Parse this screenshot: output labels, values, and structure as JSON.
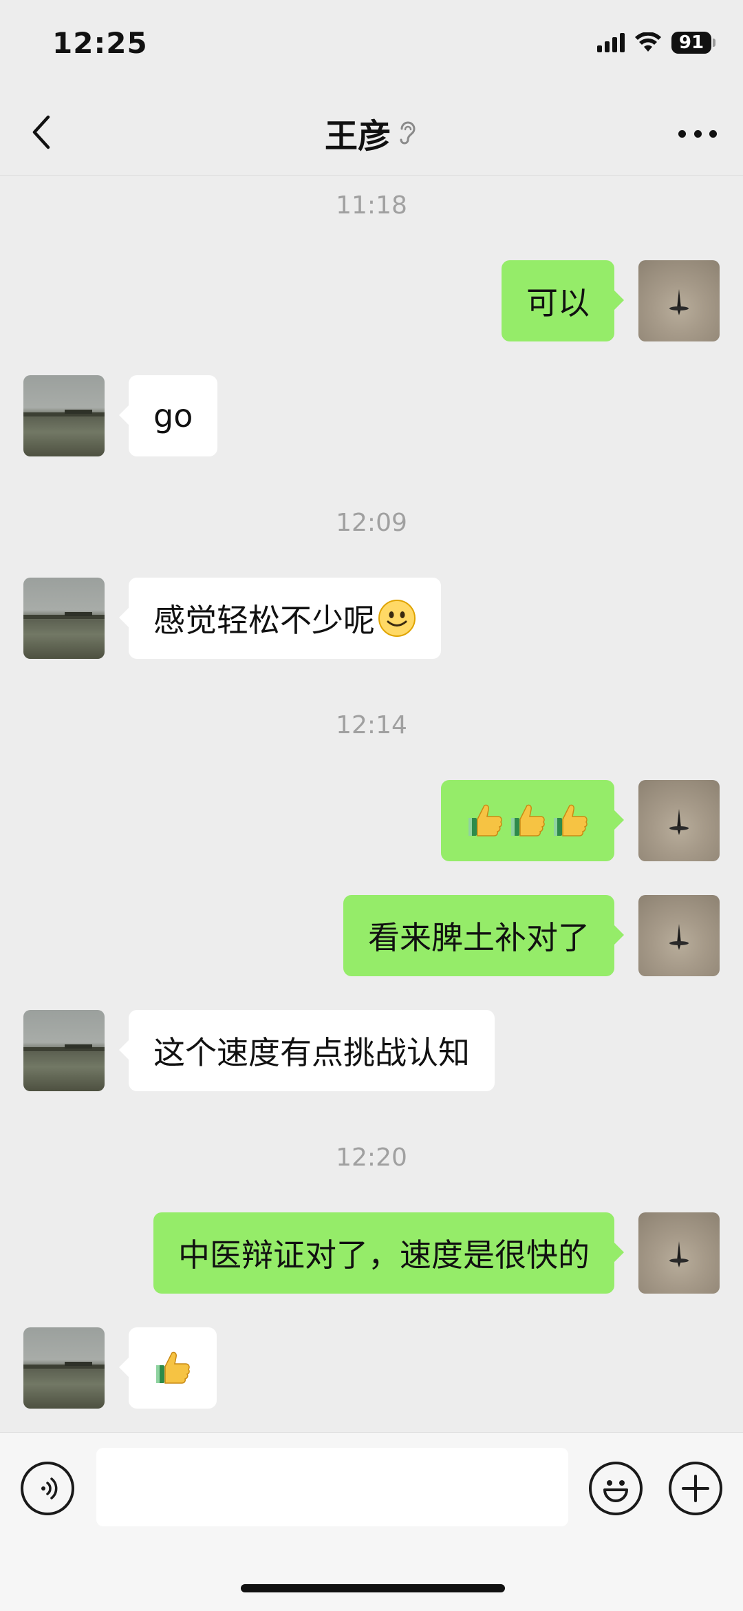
{
  "status_bar": {
    "time": "12:25",
    "battery": "91",
    "icons": [
      "cellular-signal-icon",
      "wifi-icon",
      "battery-icon"
    ]
  },
  "nav": {
    "title": "王彦",
    "icons": [
      "back-chevron-icon",
      "earpiece-mode-icon",
      "more-dots-icon"
    ]
  },
  "messages": [
    {
      "type": "time",
      "text": "11:18"
    },
    {
      "type": "msg",
      "from": "me",
      "text": "可以"
    },
    {
      "type": "msg",
      "from": "other",
      "text": "go"
    },
    {
      "type": "time",
      "text": "12:09"
    },
    {
      "type": "msg",
      "from": "other",
      "text": "感觉轻松不少呢",
      "emoji": "smile-emoji-icon"
    },
    {
      "type": "time",
      "text": "12:14"
    },
    {
      "type": "msg",
      "from": "me",
      "emoji_count": 3,
      "emoji": "thumbs-up-emoji-icon"
    },
    {
      "type": "msg",
      "from": "me",
      "text": "看来脾土补对了"
    },
    {
      "type": "msg",
      "from": "other",
      "text": "这个速度有点挑战认知"
    },
    {
      "type": "time",
      "text": "12:20"
    },
    {
      "type": "msg",
      "from": "me",
      "text": "中医辩证对了，速度是很快的"
    },
    {
      "type": "msg",
      "from": "other",
      "emoji_count": 1,
      "emoji": "thumbs-up-emoji-icon"
    }
  ],
  "input_bar": {
    "placeholder": "",
    "icons": [
      "voice-input-icon",
      "emoji-face-icon",
      "plus-icon"
    ]
  },
  "colors": {
    "background": "#ededed",
    "my_bubble": "#95ec69",
    "their_bubble": "#ffffff",
    "timestamp": "#a0a0a0"
  }
}
